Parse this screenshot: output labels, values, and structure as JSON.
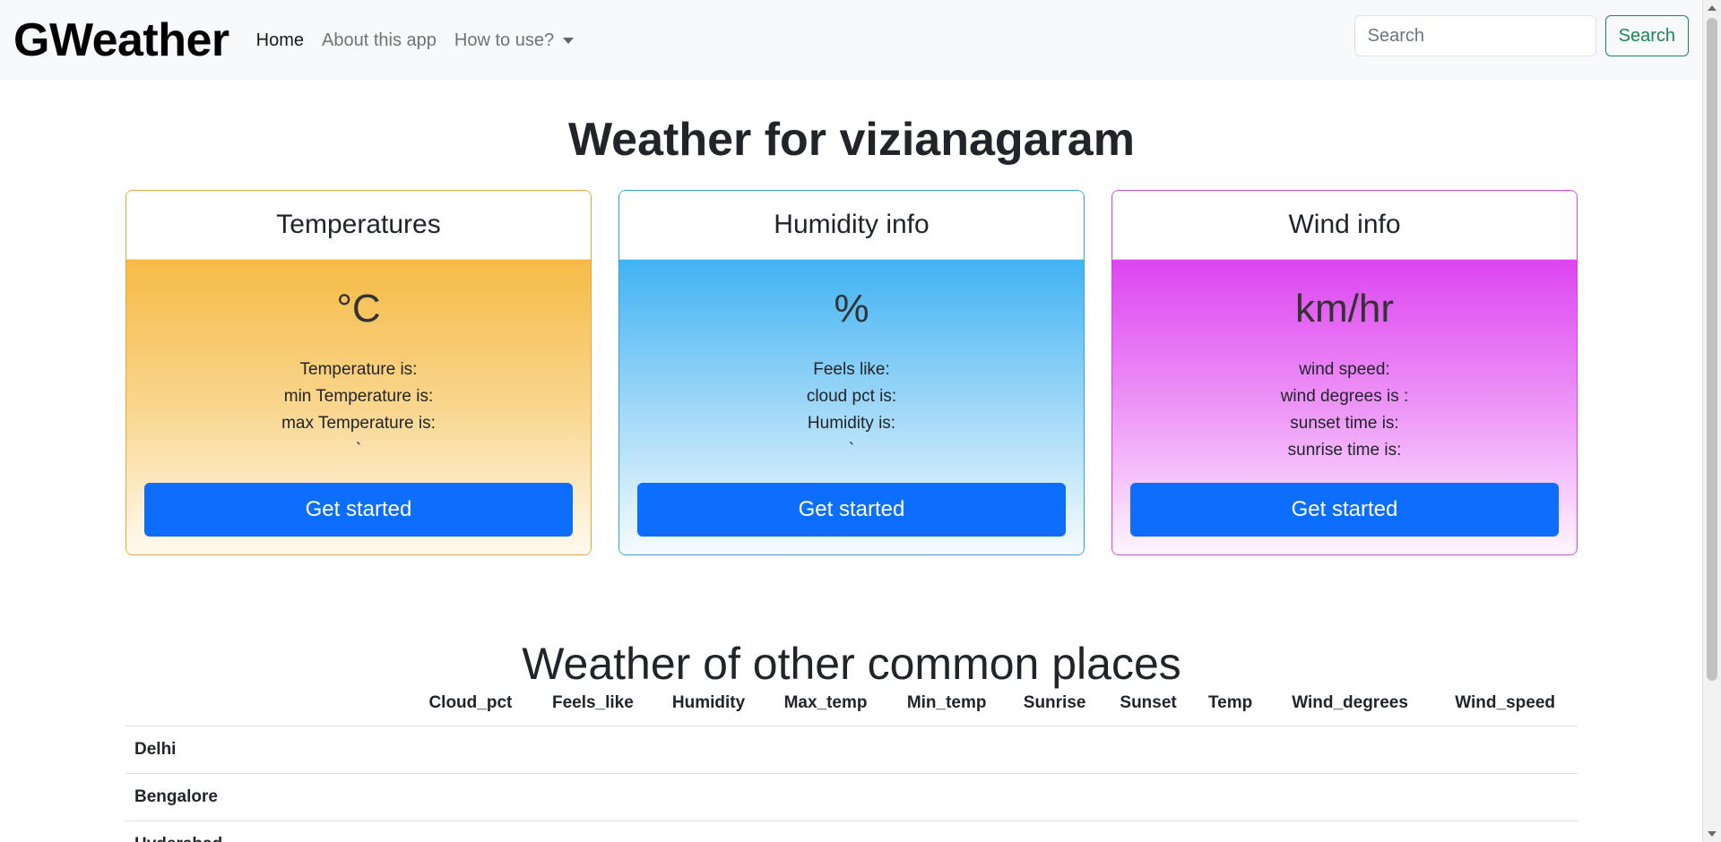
{
  "navbar": {
    "brand": "GWeather",
    "links": [
      {
        "label": "Home",
        "active": true
      },
      {
        "label": "About this app",
        "active": false
      },
      {
        "label": "How to use?",
        "active": false
      }
    ],
    "search": {
      "placeholder": "Search",
      "button_label": "Search"
    }
  },
  "page_title": "Weather for vizianagaram",
  "cards": {
    "temperature": {
      "title": "Temperatures",
      "unit": "°C",
      "lines": [
        "Temperature is:",
        "min Temperature is:",
        "max Temperature is:",
        "`"
      ],
      "button_label": "Get started"
    },
    "humidity": {
      "title": "Humidity info",
      "unit": "%",
      "lines": [
        "Feels like:",
        "cloud pct is:",
        "Humidity is:",
        "`"
      ],
      "button_label": "Get started"
    },
    "wind": {
      "title": "Wind info",
      "unit": "km/hr",
      "lines": [
        "wind speed:",
        "wind degrees is :",
        "sunset time is:",
        "sunrise time is:"
      ],
      "button_label": "Get started"
    }
  },
  "section_title": "Weather of other common places",
  "table": {
    "headers": [
      "",
      "Cloud_pct",
      "Feels_like",
      "Humidity",
      "Max_temp",
      "Min_temp",
      "Sunrise",
      "Sunset",
      "Temp",
      "Wind_degrees",
      "Wind_speed"
    ],
    "rows": [
      "Delhi",
      "Bengalore",
      "Hyderabad"
    ]
  },
  "colors": {
    "primary": "#0d6efd",
    "success": "#198754",
    "temp_gradient_top": "#f6bb46",
    "humidity_gradient_top": "#41b3f3",
    "wind_gradient_top": "#dd45f0"
  }
}
